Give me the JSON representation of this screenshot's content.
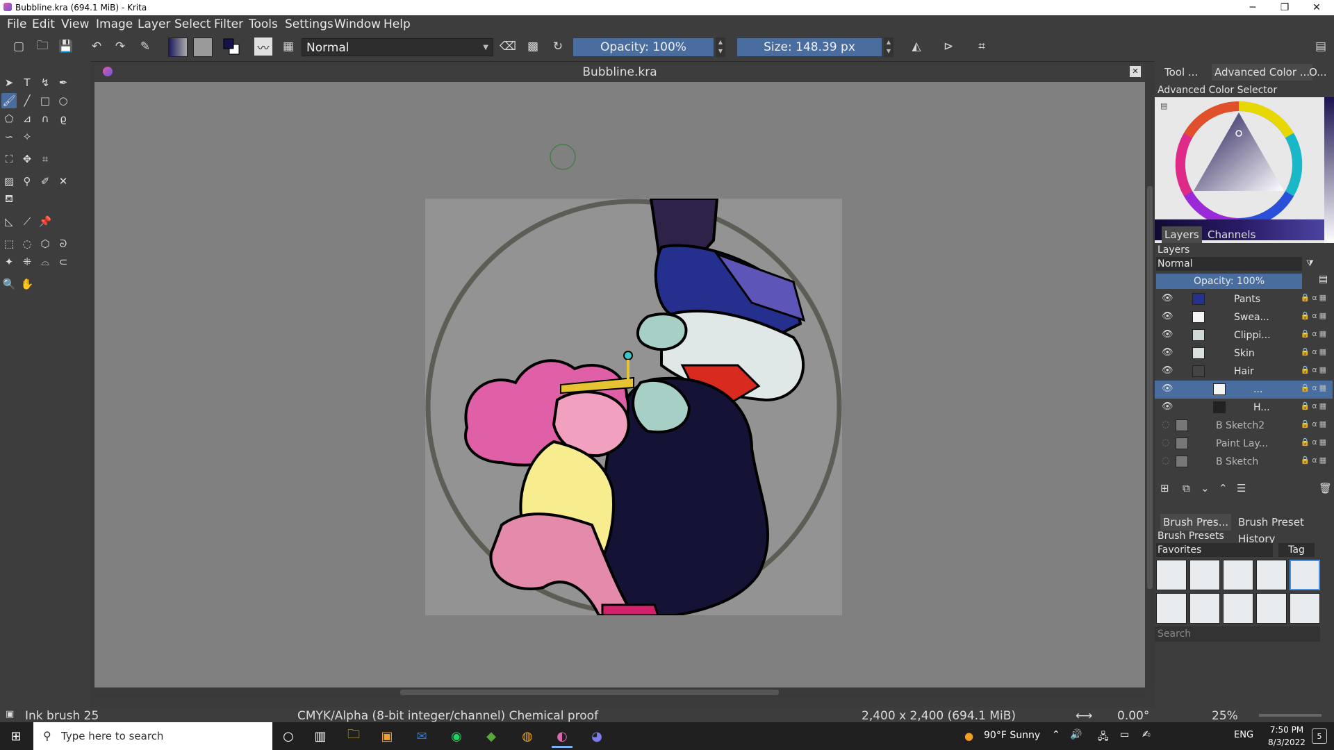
{
  "window": {
    "title": "Bubbline.kra (694.1 MiB) - Krita",
    "minimize": "─",
    "maximize": "❐",
    "close": "✕"
  },
  "menu": [
    "File",
    "Edit",
    "View",
    "Image",
    "Layer",
    "Select",
    "Filter",
    "Tools",
    "Settings",
    "Window",
    "Help"
  ],
  "toolbar": {
    "blend_mode": "Normal",
    "opacity": "Opacity: 100%",
    "size": "Size: 148.39 px"
  },
  "document": {
    "tab_title": "Bubbline.kra"
  },
  "dock": {
    "top_tabs": [
      "Tool ...",
      "Advanced Color ...",
      "O..."
    ],
    "color_selector_title": "Advanced Color Selector",
    "layer_tabs": [
      "Layers",
      "Channels"
    ],
    "layers_title": "Layers",
    "layers_blend": "Normal",
    "layers_opacity": "Opacity:  100%",
    "layers": [
      {
        "name": "Pants",
        "indent": 1
      },
      {
        "name": "Swea...",
        "indent": 1
      },
      {
        "name": "Clippi...",
        "indent": 1
      },
      {
        "name": "Skin",
        "indent": 1
      },
      {
        "name": "Hair",
        "indent": 1
      },
      {
        "name": "...",
        "indent": 2,
        "selected": true
      },
      {
        "name": "H...",
        "indent": 2
      },
      {
        "name": "B Sketch2",
        "indent": 0,
        "hidden": true
      },
      {
        "name": "Paint Lay...",
        "indent": 0,
        "hidden": true
      },
      {
        "name": "B Sketch",
        "indent": 0,
        "hidden": true
      }
    ],
    "brush_tabs": [
      "Brush Pres...",
      "Brush Preset History"
    ],
    "brush_presets_title": "Brush Presets",
    "brush_tag_select": "Favorites",
    "tag_button": "Tag",
    "search_placeholder": "Search"
  },
  "status": {
    "brush": "Ink brush 25",
    "color_space": "CMYK/Alpha (8-bit integer/channel)  Chemical proof",
    "doc_size": "2,400 x 2,400 (694.1 MiB)",
    "rotation": "0.00°",
    "zoom": "25%"
  },
  "taskbar": {
    "search_placeholder": "Type here to search",
    "weather": "90°F  Sunny",
    "lang": "ENG",
    "time": "7:50 PM",
    "date": "8/3/2022",
    "notifications": "5"
  }
}
